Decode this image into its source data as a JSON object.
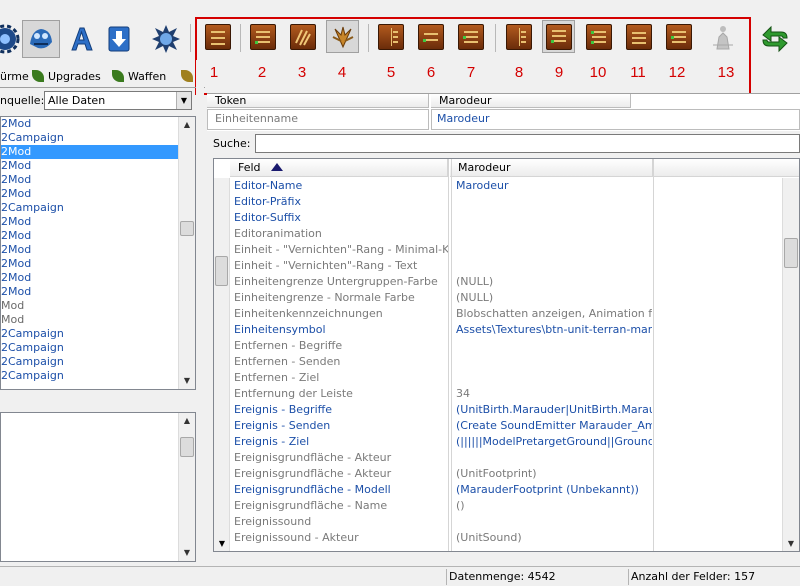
{
  "toolbar": {
    "left_icons": [
      "gear-icon",
      "creature-icon",
      "font-a-icon",
      "download-arrow-icon",
      "splash-icon"
    ],
    "numbered_buttons": [
      {
        "num": "1",
        "icon": "abacus-icon"
      },
      {
        "num": "2",
        "icon": "list-icon"
      },
      {
        "num": "3",
        "icon": "scratch-icon"
      },
      {
        "num": "4",
        "icon": "wings-icon"
      },
      {
        "num": "5",
        "icon": "book-icon"
      },
      {
        "num": "6",
        "icon": "list-icon"
      },
      {
        "num": "7",
        "icon": "list-icon"
      },
      {
        "num": "8",
        "icon": "book-icon"
      },
      {
        "num": "9",
        "icon": "list-icon"
      },
      {
        "num": "10",
        "icon": "list-icon"
      },
      {
        "num": "11",
        "icon": "list-icon"
      },
      {
        "num": "12",
        "icon": "list-icon"
      },
      {
        "num": "13",
        "icon": "figure-icon"
      }
    ],
    "right_icon": "sc-refresh-icon",
    "highlight_color": "#d40000"
  },
  "left_panel": {
    "tabs": [
      {
        "label": "ürme"
      },
      {
        "label": "Upgrades"
      },
      {
        "label": "Waffen"
      }
    ],
    "source_label": "nquelle:",
    "source_value": "Alle Daten",
    "items": [
      {
        "text": "2Mod",
        "style": "normal"
      },
      {
        "text": "2Campaign",
        "style": "normal"
      },
      {
        "text": "2Mod",
        "style": "selected"
      },
      {
        "text": "2Mod",
        "style": "normal"
      },
      {
        "text": "2Mod",
        "style": "normal"
      },
      {
        "text": "2Mod",
        "style": "normal"
      },
      {
        "text": "2Campaign",
        "style": "normal"
      },
      {
        "text": "2Mod",
        "style": "normal"
      },
      {
        "text": "2Mod",
        "style": "normal"
      },
      {
        "text": "2Mod",
        "style": "normal"
      },
      {
        "text": "2Mod",
        "style": "normal"
      },
      {
        "text": "2Mod",
        "style": "normal"
      },
      {
        "text": "2Mod",
        "style": "normal"
      },
      {
        "text": "Mod",
        "style": "gray"
      },
      {
        "text": "Mod",
        "style": "gray"
      },
      {
        "text": "2Campaign",
        "style": "normal"
      },
      {
        "text": "2Campaign",
        "style": "normal"
      },
      {
        "text": "2Campaign",
        "style": "normal"
      },
      {
        "text": "2Campaign",
        "style": "normal"
      }
    ]
  },
  "header_table": {
    "col1_header": "Token",
    "col2_header": "Marodeur",
    "row_label": "Einheitenname",
    "row_value": "Marodeur"
  },
  "search": {
    "label": "Suche:",
    "value": ""
  },
  "grid": {
    "col_field": "Feld",
    "col_value": "Marodeur",
    "rows": [
      {
        "k": "Editor-Name",
        "ks": "blue",
        "v": "Marodeur",
        "vs": "blue"
      },
      {
        "k": "Editor-Präfix",
        "ks": "blue",
        "v": "",
        "vs": "blue"
      },
      {
        "k": "Editor-Suffix",
        "ks": "blue",
        "v": "",
        "vs": "blue"
      },
      {
        "k": "Editoranimation",
        "ks": "gray",
        "v": "",
        "vs": "gray"
      },
      {
        "k": "Einheit - \"Vernichten\"-Rang - Minimal-Kills",
        "ks": "gray",
        "v": "",
        "vs": "gray"
      },
      {
        "k": "Einheit - \"Vernichten\"-Rang - Text",
        "ks": "gray",
        "v": "",
        "vs": "gray"
      },
      {
        "k": "Einheitengrenze  Untergruppen-Farbe",
        "ks": "gray",
        "v": "(NULL)",
        "vs": "gray"
      },
      {
        "k": "Einheitengrenze - Normale Farbe",
        "ks": "gray",
        "v": "(NULL)",
        "vs": "gray"
      },
      {
        "k": "Einheitenkennzeichnungen",
        "ks": "gray",
        "v": "Blobschatten anzeigen, Animation für Ste",
        "vs": "gray"
      },
      {
        "k": "Einheitensymbol",
        "ks": "blue",
        "v": "Assets\\Textures\\btn-unit-terran-marauder",
        "vs": "blue"
      },
      {
        "k": "Entfernen - Begriffe",
        "ks": "gray",
        "v": "",
        "vs": "gray"
      },
      {
        "k": "Entfernen - Senden",
        "ks": "gray",
        "v": "",
        "vs": "gray"
      },
      {
        "k": "Entfernen - Ziel",
        "ks": "gray",
        "v": "",
        "vs": "gray"
      },
      {
        "k": "Entfernung der Leiste",
        "ks": "gray",
        "v": "34",
        "vs": "gray"
      },
      {
        "k": "Ereignis - Begriffe",
        "ks": "blue",
        "v": "(UnitBirth.Marauder|UnitBirth.Marauder|Ur",
        "vs": "blue"
      },
      {
        "k": "Ereignis - Senden",
        "ks": "blue",
        "v": "(Create SoundEmitter Marauder_Ambienc",
        "vs": "blue"
      },
      {
        "k": "Ereignis - Ziel",
        "ks": "blue",
        "v": "(||||||ModelPretargetGround||GroundPreSe",
        "vs": "blue"
      },
      {
        "k": "Ereignisgrundfläche - Akteur",
        "ks": "gray",
        "v": "",
        "vs": "gray"
      },
      {
        "k": "Ereignisgrundfläche - Akteur",
        "ks": "gray",
        "v": "(UnitFootprint)",
        "vs": "gray"
      },
      {
        "k": "Ereignisgrundfläche - Modell",
        "ks": "blue",
        "v": "(MarauderFootprint (Unbekannt))",
        "vs": "blue"
      },
      {
        "k": "Ereignisgrundfläche - Name",
        "ks": "gray",
        "v": "()",
        "vs": "gray"
      },
      {
        "k": "Ereignissound",
        "ks": "gray",
        "v": "",
        "vs": "gray"
      },
      {
        "k": "Ereignissound - Akteur",
        "ks": "gray",
        "v": "(UnitSound)",
        "vs": "gray"
      }
    ]
  },
  "status": {
    "count_label": "Datenmenge: 4542",
    "fields_label": "Anzahl der Felder: 157"
  }
}
